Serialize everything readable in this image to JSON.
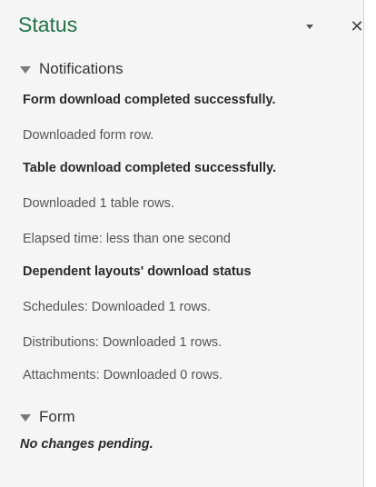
{
  "pane": {
    "title": "Status"
  },
  "notifications": {
    "header": "Notifications",
    "items": [
      {
        "text": "Form download completed successfully.",
        "bold": true
      },
      {
        "text": "Downloaded form row.",
        "bold": false
      },
      {
        "text": "Table download completed successfully.",
        "bold": true
      },
      {
        "text": "Downloaded 1 table rows.",
        "bold": false
      },
      {
        "text": "Elapsed time: less than one second",
        "bold": false
      },
      {
        "text": "Dependent layouts' download status",
        "bold": true
      },
      {
        "text": "Schedules: Downloaded 1 rows.",
        "bold": false
      },
      {
        "text": "Distributions: Downloaded 1 rows.",
        "bold": false
      },
      {
        "text": "Attachments: Downloaded 0 rows.",
        "bold": false
      }
    ]
  },
  "form": {
    "header": "Form",
    "message": "No changes pending."
  },
  "icons": {
    "dropdown": "chevron-down-icon",
    "close": "close-icon",
    "collapse": "triangle-down-icon"
  },
  "colors": {
    "title": "#217346",
    "background": "#f5f5f5"
  }
}
